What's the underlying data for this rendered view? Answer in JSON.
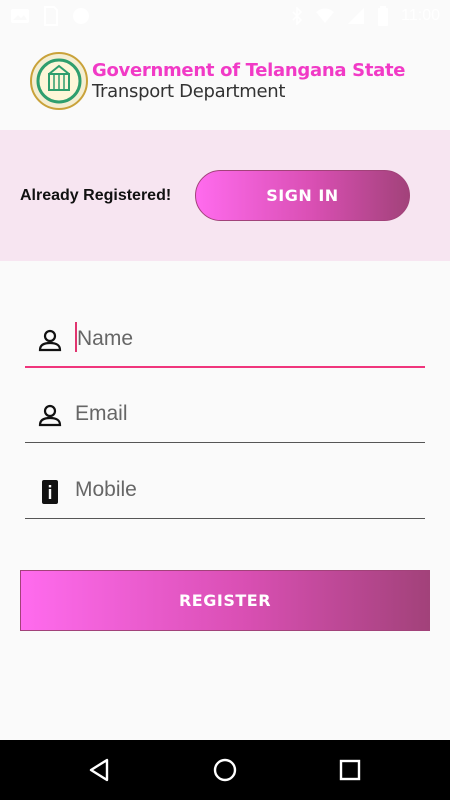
{
  "status_bar": {
    "time": "11:00",
    "icons": [
      "image-icon",
      "sim-icon",
      "circle-notification-icon",
      "bluetooth-icon",
      "wifi-icon",
      "signal-icon",
      "battery-icon"
    ]
  },
  "header": {
    "title": "Government of Telangana State",
    "subtitle": "Transport Department",
    "emblem_icon": "telangana-emblem-icon"
  },
  "signin": {
    "label": "Already Registered!",
    "button_label": "SIGN IN"
  },
  "form": {
    "name_placeholder": "Name",
    "email_placeholder": "Email",
    "mobile_placeholder": "Mobile",
    "register_label": "REGISTER"
  },
  "colors": {
    "accent_pink": "#f13ac6",
    "gradient_start": "#ff6bee",
    "gradient_end": "#a2427a",
    "band_background": "#f7e5f1",
    "active_underline": "#f0357c"
  }
}
